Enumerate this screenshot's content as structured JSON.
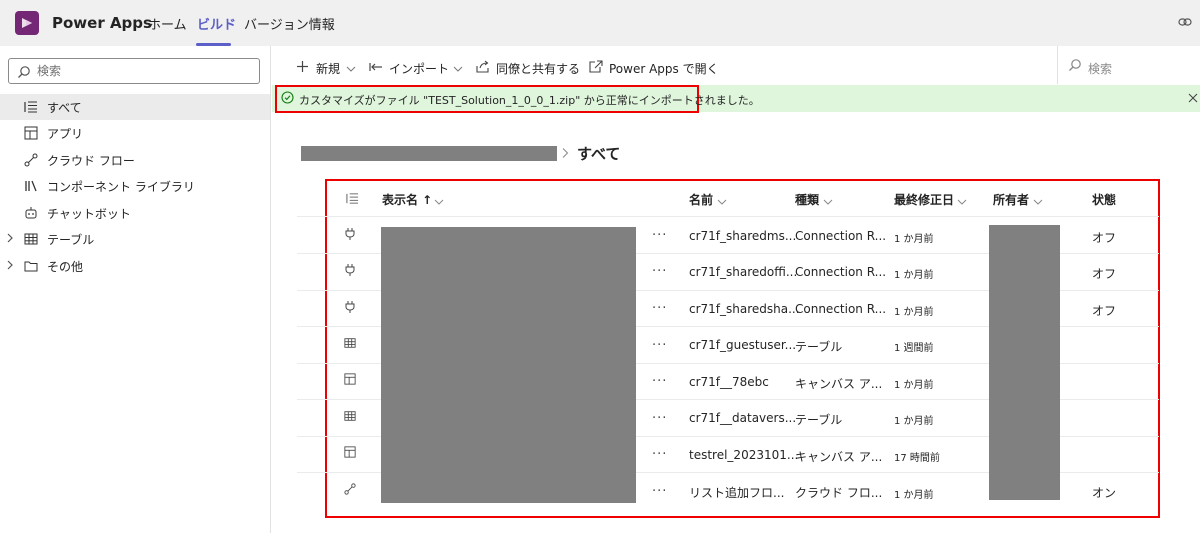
{
  "app": {
    "name": "Power Apps",
    "tabs": [
      {
        "label": "ホーム",
        "active": false
      },
      {
        "label": "ビルド",
        "active": true
      },
      {
        "label": "バージョン情報",
        "active": false
      }
    ],
    "brand_color": "#742774",
    "accent_color": "#5b5fc7"
  },
  "sidebar": {
    "search_placeholder": "検索",
    "items": [
      {
        "label": "すべて",
        "icon": "list-icon",
        "active": true
      },
      {
        "label": "アプリ",
        "icon": "app-icon"
      },
      {
        "label": "クラウド フロー",
        "icon": "flow-icon"
      },
      {
        "label": "コンポーネント ライブラリ",
        "icon": "library-icon"
      },
      {
        "label": "チャットボット",
        "icon": "bot-icon"
      },
      {
        "label": "テーブル",
        "icon": "table-icon",
        "expandable": true
      },
      {
        "label": "その他",
        "icon": "folder-icon",
        "expandable": true
      }
    ]
  },
  "commands": {
    "new": "新規",
    "import": "インポート",
    "share": "同僚と共有する",
    "open": "Power Apps で開く",
    "search_label": "検索"
  },
  "banner": {
    "text": "カスタマイズがファイル \"TEST_Solution_1_0_0_1.zip\" から正常にインポートされました。",
    "status_color": "#107c10"
  },
  "breadcrumb": {
    "current": "すべて"
  },
  "table": {
    "columns": {
      "display_name": "表示名 ↑",
      "name": "名前",
      "type": "種類",
      "modified": "最終修正日",
      "owner": "所有者",
      "status": "状態"
    },
    "rows": [
      {
        "icon": "plug-icon",
        "name": "cr71f_sharedms...",
        "type": "Connection R...",
        "modified": "1 か月前",
        "status": "オフ"
      },
      {
        "icon": "plug-icon",
        "name": "cr71f_sharedoffi...",
        "type": "Connection R...",
        "modified": "1 か月前",
        "status": "オフ"
      },
      {
        "icon": "plug-icon",
        "name": "cr71f_sharedsha...",
        "type": "Connection R...",
        "modified": "1 か月前",
        "status": "オフ"
      },
      {
        "icon": "table-icon",
        "name": "cr71f_guestuser...",
        "type": "テーブル",
        "modified": "1 週間前",
        "status": ""
      },
      {
        "icon": "app-icon",
        "name": "cr71f__78ebc",
        "type": "キャンバス ア...",
        "modified": "1 か月前",
        "status": ""
      },
      {
        "icon": "table-icon",
        "name": "cr71f__datavers...",
        "type": "テーブル",
        "modified": "1 か月前",
        "status": ""
      },
      {
        "icon": "app-icon",
        "name": "testrel_2023101...",
        "type": "キャンバス ア...",
        "modified": "17 時間前",
        "status": ""
      },
      {
        "icon": "flow-icon",
        "name": "リスト追加フロ...",
        "type": "クラウド フロ...",
        "modified": "1 か月前",
        "status": "オン"
      }
    ]
  }
}
